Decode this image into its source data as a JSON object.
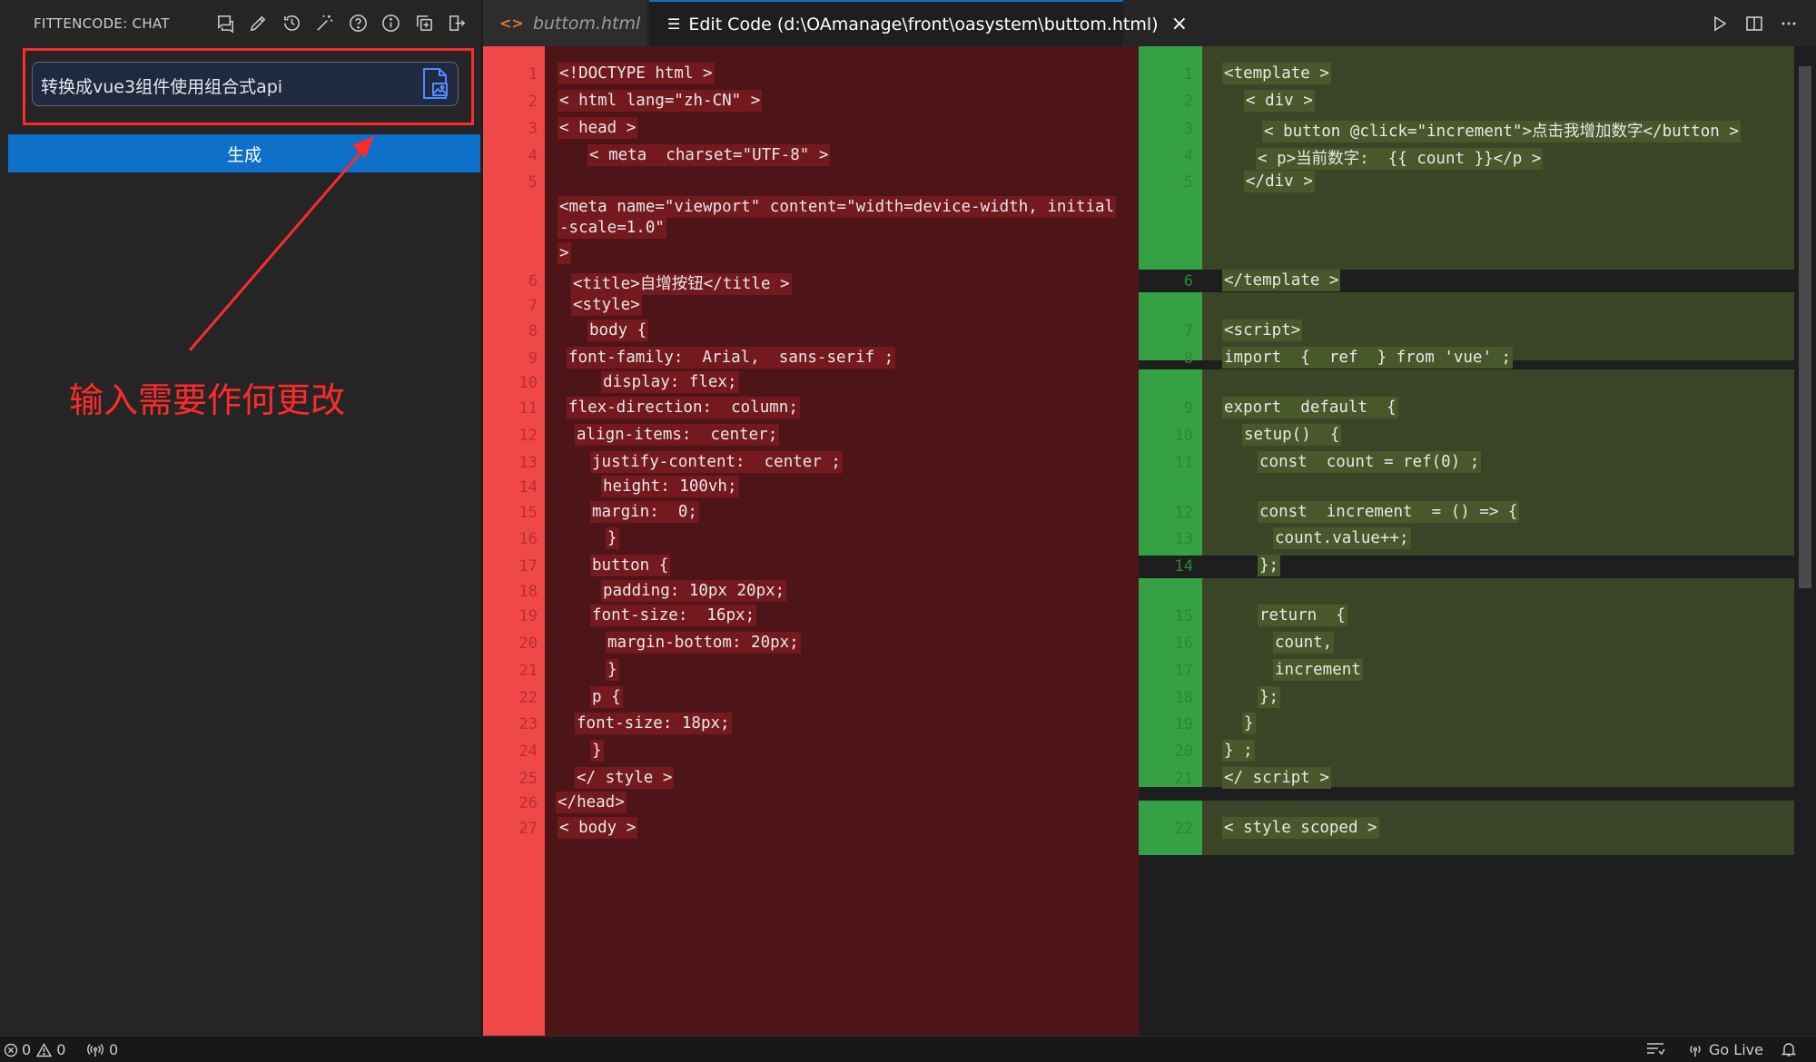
{
  "sidebar": {
    "title": "FITTENCODE: CHAT",
    "icons": [
      "new-chat-icon",
      "edit-icon",
      "history-icon",
      "magic-wand-icon",
      "help-icon",
      "info-icon",
      "copy-icon",
      "export-icon"
    ],
    "prompt": {
      "value": "转换成vue3组件使用组合式api",
      "image_icon": "image-upload-icon"
    },
    "generate_label": "生成",
    "annotation": "输入需要作何更改"
  },
  "tabs": [
    {
      "label": "buttom.html",
      "icon": "html-file-icon",
      "active": false
    },
    {
      "label": "Edit Code (d:\\OAmanage\\front\\oasystem\\buttom.html)",
      "icon": "diff-icon",
      "active": true,
      "close": "×"
    }
  ],
  "toolbar_icons": [
    "run-icon",
    "split-editor-icon",
    "more-icon"
  ],
  "diff_left": [
    {
      "n": "1",
      "text": "<!DOCTYPE html >"
    },
    {
      "n": "2",
      "text": "< html lang=\"zh-CN\" >"
    },
    {
      "n": "3",
      "text": "< head >"
    },
    {
      "n": "4",
      "text": "< meta  charset=\"UTF-8\" >"
    },
    {
      "n": "5",
      "text": ""
    },
    {
      "n": "",
      "text": "<meta name=\"viewport\" content=\"width=device-width, initial"
    },
    {
      "n": "",
      "text": "-scale=1.0\""
    },
    {
      "n": "",
      "text": ">"
    },
    {
      "n": "6",
      "text": "<title>自增按钮</title >"
    },
    {
      "n": "7",
      "text": "<style>"
    },
    {
      "n": "8",
      "text": "body {"
    },
    {
      "n": "9",
      "text": "font-family:  Arial,  sans-serif ;"
    },
    {
      "n": "10",
      "text": "display: flex;"
    },
    {
      "n": "11",
      "text": "flex-direction:  column;"
    },
    {
      "n": "12",
      "text": "align-items:  center;"
    },
    {
      "n": "13",
      "text": "justify-content:  center ;"
    },
    {
      "n": "14",
      "text": "height: 100vh;"
    },
    {
      "n": "15",
      "text": "margin:  0;"
    },
    {
      "n": "16",
      "text": "}"
    },
    {
      "n": "17",
      "text": "button {"
    },
    {
      "n": "18",
      "text": "padding: 10px 20px;"
    },
    {
      "n": "19",
      "text": "font-size:  16px;"
    },
    {
      "n": "20",
      "text": "margin-bottom: 20px;"
    },
    {
      "n": "21",
      "text": "}"
    },
    {
      "n": "22",
      "text": "p {"
    },
    {
      "n": "23",
      "text": "font-size: 18px;"
    },
    {
      "n": "24",
      "text": "}"
    },
    {
      "n": "25",
      "text": "</ style >"
    },
    {
      "n": "26",
      "text": "</head>"
    },
    {
      "n": "27",
      "text": "< body >"
    }
  ],
  "diff_right": [
    {
      "n": "1",
      "text": "<template >"
    },
    {
      "n": "2",
      "text": "< div >"
    },
    {
      "n": "3",
      "text": "< button @click=\"increment\">点击我增加数字</button >"
    },
    {
      "n": "4",
      "text": "< p>当前数字:  {{ count }}</p >"
    },
    {
      "n": "5",
      "text": "</div >"
    },
    {
      "n": "6",
      "text": "</template >"
    },
    {
      "n": "7",
      "text": "<script>"
    },
    {
      "n": "8",
      "text": "import  {  ref  } from 'vue' ;"
    },
    {
      "n": "9",
      "text": "export  default  {"
    },
    {
      "n": "10",
      "text": "setup()  {"
    },
    {
      "n": "11",
      "text": "const  count = ref(0) ;"
    },
    {
      "n": "12",
      "text": "const  increment  = () => {"
    },
    {
      "n": "13",
      "text": "count.value++;"
    },
    {
      "n": "14",
      "text": "};"
    },
    {
      "n": "15",
      "text": "return  {"
    },
    {
      "n": "16",
      "text": "count,"
    },
    {
      "n": "17",
      "text": "increment"
    },
    {
      "n": "18",
      "text": "};"
    },
    {
      "n": "19",
      "text": "}"
    },
    {
      "n": "20",
      "text": "} ;"
    },
    {
      "n": "21",
      "text": "</ script >"
    },
    {
      "n": "22",
      "text": "< style scoped >"
    }
  ],
  "status": {
    "errors": "0",
    "warnings": "0",
    "ports": "0",
    "go_live": "Go Live"
  },
  "colors": {
    "removed_bg": "#4d1518",
    "removed_gutter": "#f04848",
    "added_bg": "#3a4528",
    "added_gutter": "#36a044",
    "annotation": "#ff2a2a",
    "accent": "#0e70c8"
  }
}
